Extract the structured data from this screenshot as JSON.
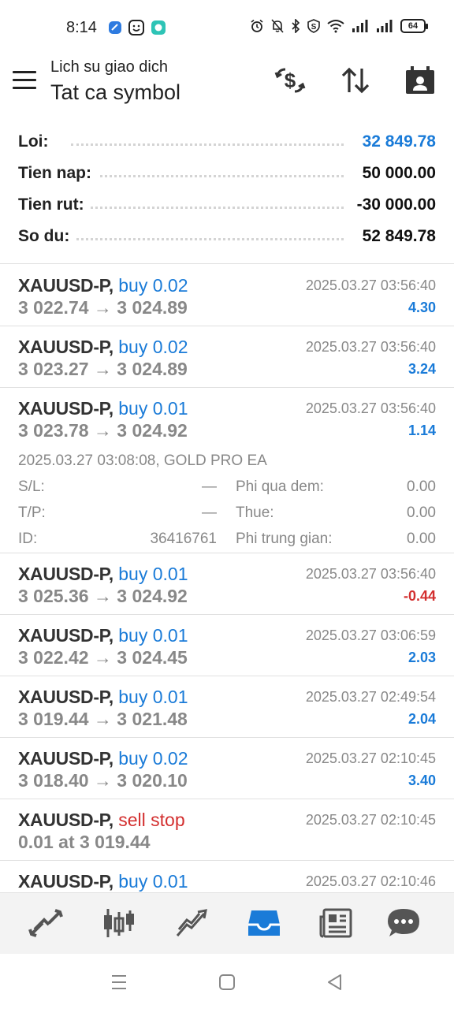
{
  "status_bar": {
    "time": "8:14",
    "battery": "64",
    "left_icons": [
      "app-blue-icon",
      "smiley-app-icon",
      "chat-app-icon"
    ],
    "right_icons": [
      "alarm-icon",
      "mute-icon",
      "bluetooth-icon",
      "shield-icon",
      "wifi-icon",
      "signal-icon",
      "signal-icon",
      "battery-icon"
    ]
  },
  "header": {
    "subtitle": "Lich su giao dich",
    "title": "Tat ca symbol",
    "icons": [
      "currency-exchange-icon",
      "sort-icon",
      "calendar-user-icon"
    ]
  },
  "summary": [
    {
      "label": "Loi:",
      "value": "32 849.78",
      "color": "#1a7bd8"
    },
    {
      "label": "Tien nap:",
      "value": "50 000.00",
      "color": "#111111"
    },
    {
      "label": "Tien rut:",
      "value": "-30 000.00",
      "color": "#111111"
    },
    {
      "label": "So du:",
      "value": "52 849.78",
      "color": "#111111"
    }
  ],
  "trades": [
    {
      "symbol": "XAUUSD-P,",
      "type": "buy 0.02",
      "prices": "3 022.74 → 3 024.89",
      "time": "2025.03.27 03:56:40",
      "profit": "4.30"
    },
    {
      "symbol": "XAUUSD-P,",
      "type": "buy 0.02",
      "prices": "3 023.27 → 3 024.89",
      "time": "2025.03.27 03:56:40",
      "profit": "3.24"
    },
    {
      "symbol": "XAUUSD-P,",
      "type": "buy 0.01",
      "prices": "3 023.78 → 3 024.92",
      "time": "2025.03.27 03:56:40",
      "profit": "1.14",
      "detail": {
        "open_line": "2025.03.27 03:08:08, GOLD PRO EA",
        "sl_label": "S/L:",
        "sl_value": "—",
        "tp_label": "T/P:",
        "tp_value": "—",
        "id_label": "ID:",
        "id_value": "36416761",
        "swap_label": "Phi qua dem:",
        "swap_value": "0.00",
        "tax_label": "Thue:",
        "tax_value": "0.00",
        "commission_label": "Phi trung gian:",
        "commission_value": "0.00"
      }
    },
    {
      "symbol": "XAUUSD-P,",
      "type": "buy 0.01",
      "prices": "3 025.36 → 3 024.92",
      "time": "2025.03.27 03:56:40",
      "profit": "-0.44"
    },
    {
      "symbol": "XAUUSD-P,",
      "type": "buy 0.01",
      "prices": "3 022.42 → 3 024.45",
      "time": "2025.03.27 03:06:59",
      "profit": "2.03"
    },
    {
      "symbol": "XAUUSD-P,",
      "type": "buy 0.01",
      "prices": "3 019.44 → 3 021.48",
      "time": "2025.03.27 02:49:54",
      "profit": "2.04"
    },
    {
      "symbol": "XAUUSD-P,",
      "type": "buy 0.02",
      "prices": "3 018.40 → 3 020.10",
      "time": "2025.03.27 02:10:45",
      "profit": "3.40"
    },
    {
      "symbol": "XAUUSD-P,",
      "type": "sell stop",
      "prices": "0.01 at 3 019.44",
      "time": "2025.03.27 02:10:45",
      "profit": ""
    },
    {
      "symbol": "XAUUSD-P,",
      "type": "buy 0.01",
      "prices": "",
      "time": "2025.03.27 02:10:46",
      "profit": ""
    }
  ],
  "bottom_nav": {
    "items": [
      "quotes-icon",
      "chart-icon",
      "trade-icon",
      "history-icon",
      "news-icon",
      "messages-icon"
    ],
    "active": "history-icon",
    "active_color": "#1a7bd8"
  },
  "system_nav": [
    "recents-icon",
    "home-icon",
    "back-icon"
  ]
}
